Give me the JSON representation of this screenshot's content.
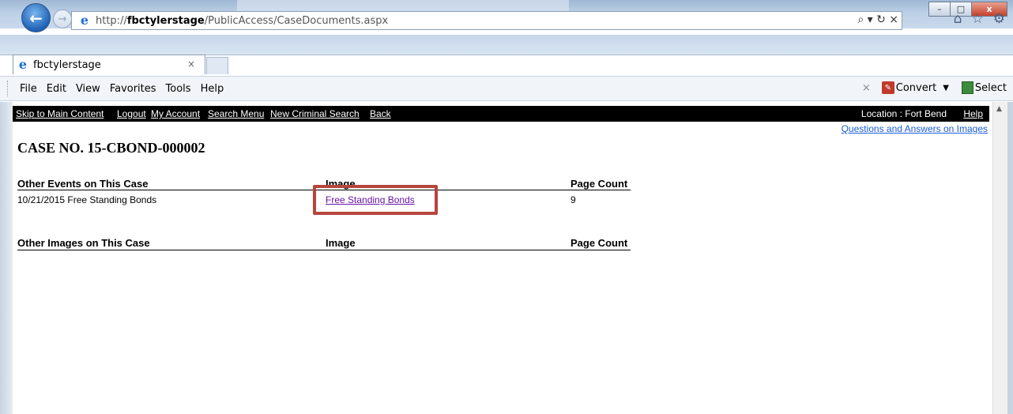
{
  "browser": {
    "address_url_prefix": "http://",
    "address_url_host": "fbctylerstage",
    "address_url_path": "/PublicAccess/CaseDocuments.aspx",
    "tab_title": "fbctylerstage",
    "tab_close": "×",
    "window_minimize": "–",
    "window_maximize": "□",
    "window_close": "x",
    "address_tools": "⌕ ▾ ↻ ×",
    "right_icons": [
      "⌂",
      "☆",
      "⚙"
    ]
  },
  "menubar": {
    "items": [
      "File",
      "Edit",
      "View",
      "Favorites",
      "Tools",
      "Help"
    ],
    "close": "×",
    "convert_label": "Convert",
    "select_label": "Select"
  },
  "topnav": {
    "links": [
      "Skip to Main Content",
      "Logout",
      "My Account",
      "Search Menu",
      "New Criminal Search",
      "Back"
    ],
    "location": "Location : Fort Bend",
    "help": "Help",
    "qa_link": "Questions and Answers on Images"
  },
  "case": {
    "title": "CASE NO. 15-CBOND-000002"
  },
  "events_table": {
    "headers": [
      "Other Events on This Case",
      "Image",
      "Page Count"
    ],
    "rows": [
      {
        "event": "10/21/2015 Free Standing Bonds",
        "image_link": "Free Standing Bonds",
        "page_count": "9"
      }
    ]
  },
  "images_table": {
    "headers": [
      "Other Images on This Case",
      "Image",
      "Page Count"
    ]
  },
  "colors": {
    "highlight_box": "#b5463e",
    "visited_link": "#6b14a5",
    "link": "#1a5fd6",
    "nav_bar": "#000000"
  }
}
